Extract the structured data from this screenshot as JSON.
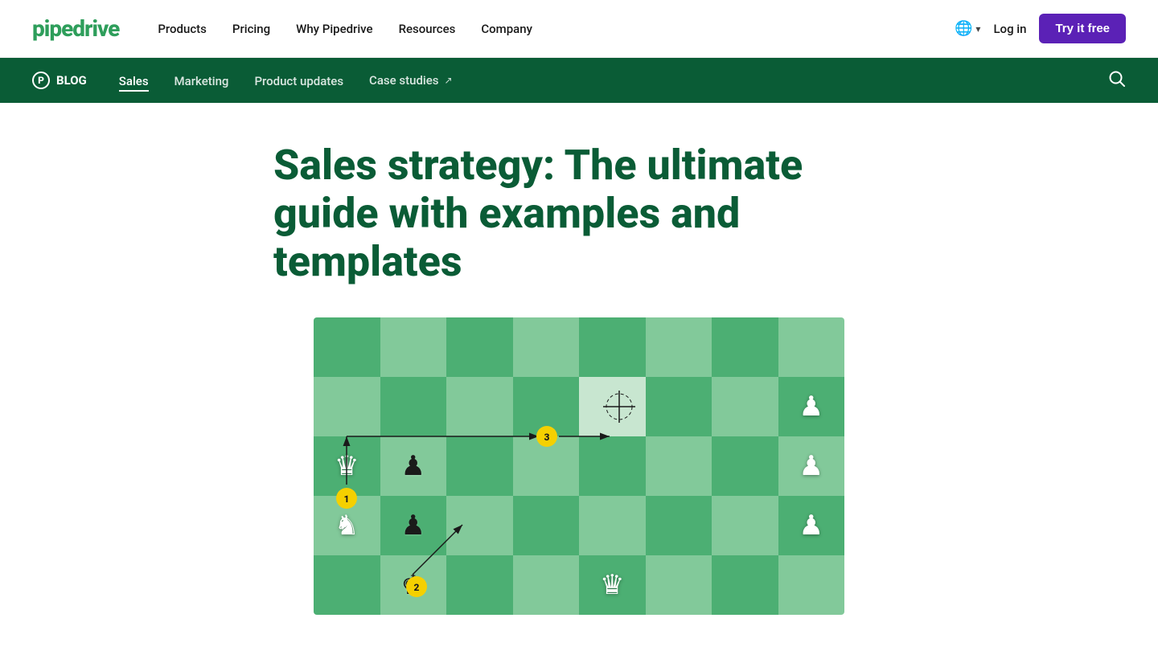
{
  "logo": {
    "text": "pipedrive",
    "color": "#2e9e5b"
  },
  "topNav": {
    "links": [
      {
        "label": "Products",
        "href": "#"
      },
      {
        "label": "Pricing",
        "href": "#"
      },
      {
        "label": "Why Pipedrive",
        "href": "#"
      },
      {
        "label": "Resources",
        "href": "#"
      },
      {
        "label": "Company",
        "href": "#"
      }
    ],
    "login_label": "Log in",
    "try_free_label": "Try it free",
    "lang_icon": "🌐",
    "chevron": "▾"
  },
  "blogNav": {
    "blog_label": "BLOG",
    "p_letter": "P",
    "links": [
      {
        "label": "Sales",
        "active": true
      },
      {
        "label": "Marketing",
        "active": false
      },
      {
        "label": "Product updates",
        "active": false
      },
      {
        "label": "Case studies",
        "active": false,
        "external": true
      }
    ],
    "search_icon": "🔍"
  },
  "article": {
    "title": "Sales strategy: The ultimate guide with examples and templates"
  },
  "chess": {
    "badges": [
      {
        "id": 1,
        "label": "1"
      },
      {
        "id": 2,
        "label": "2"
      },
      {
        "id": 3,
        "label": "3"
      }
    ]
  }
}
